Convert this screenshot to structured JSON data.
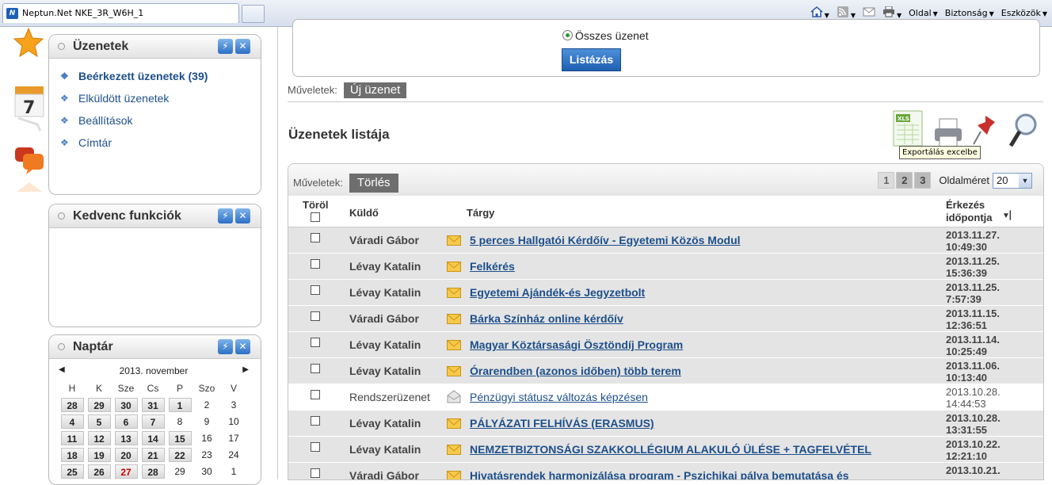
{
  "browser": {
    "tab_title": "Neptun.Net NKE_3R_W6H_1",
    "favicon_label": "N",
    "menu_page": "Oldal",
    "menu_security": "Biztonság",
    "menu_tools": "Eszközök"
  },
  "sidebar": {
    "messages_box": {
      "title": "Üzenetek",
      "items": [
        {
          "label": "Beérkezett üzenetek (39)",
          "active": true
        },
        {
          "label": "Elküldött üzenetek"
        },
        {
          "label": "Beállítások"
        },
        {
          "label": "Címtár"
        }
      ]
    },
    "favorites_box": {
      "title": "Kedvenc funkciók"
    },
    "calendar_box": {
      "title": "Naptár",
      "month": "2013. november",
      "weekdays": [
        "H",
        "K",
        "Sze",
        "Cs",
        "P",
        "Szo",
        "V"
      ],
      "weeks": [
        [
          {
            "d": "28",
            "btn": true
          },
          {
            "d": "29",
            "btn": true
          },
          {
            "d": "30",
            "btn": true
          },
          {
            "d": "31",
            "btn": true
          },
          {
            "d": "1",
            "btn": true
          },
          {
            "d": "2"
          },
          {
            "d": "3"
          }
        ],
        [
          {
            "d": "4",
            "btn": true
          },
          {
            "d": "5",
            "btn": true
          },
          {
            "d": "6",
            "btn": true
          },
          {
            "d": "7",
            "btn": true
          },
          {
            "d": "8"
          },
          {
            "d": "9"
          },
          {
            "d": "10"
          }
        ],
        [
          {
            "d": "11",
            "btn": true
          },
          {
            "d": "12",
            "btn": true
          },
          {
            "d": "13",
            "btn": true
          },
          {
            "d": "14",
            "btn": true
          },
          {
            "d": "15",
            "btn": true
          },
          {
            "d": "16"
          },
          {
            "d": "17"
          }
        ],
        [
          {
            "d": "18",
            "btn": true
          },
          {
            "d": "19",
            "btn": true
          },
          {
            "d": "20",
            "btn": true
          },
          {
            "d": "21",
            "btn": true
          },
          {
            "d": "22",
            "btn": true
          },
          {
            "d": "23"
          },
          {
            "d": "24"
          }
        ],
        [
          {
            "d": "25",
            "btn": true
          },
          {
            "d": "26",
            "btn": true
          },
          {
            "d": "27",
            "btn": true,
            "red": true
          },
          {
            "d": "28",
            "btn": true
          },
          {
            "d": "29"
          },
          {
            "d": "30"
          },
          {
            "d": "1"
          }
        ]
      ]
    }
  },
  "filter": {
    "radio_label": "Összes üzenet",
    "list_button": "Listázás"
  },
  "operations": {
    "label": "Műveletek:",
    "new_message": "Új üzenet"
  },
  "list": {
    "title": "Üzenetek listája",
    "toolbar_icons": [
      "excel-export-icon",
      "print-icon",
      "pin-icon",
      "search-icon"
    ],
    "excel_icon_text": "XLS",
    "tooltip": "Exportálás excelbe",
    "ops_label": "Műveletek:",
    "delete_button": "Törlés",
    "pages": [
      "1",
      "2",
      "3"
    ],
    "current_page": "1",
    "page_size_label": "Oldalméret",
    "page_size": "20",
    "columns": {
      "delete": "Töröl",
      "sender": "Küldő",
      "subject": "Tárgy",
      "date_line1": "Érkezés",
      "date_line2": "időpontja"
    },
    "rows": [
      {
        "sender": "Váradi Gábor",
        "subject": "5 perces Hallgatói Kérdőív - Egyetemi Közös Modul",
        "date1": "2013.11.27.",
        "date2": "10:49:30",
        "unread": true
      },
      {
        "sender": "Lévay Katalin",
        "subject": "Felkérés",
        "date1": "2013.11.25.",
        "date2": "15:36:39",
        "unread": true
      },
      {
        "sender": "Lévay Katalin",
        "subject": "Egyetemi Ajándék-és Jegyzetbolt",
        "date1": "2013.11.25.",
        "date2": "7:57:39",
        "unread": true
      },
      {
        "sender": "Váradi Gábor",
        "subject": "Bárka Színház online kérdőív",
        "date1": "2013.11.15.",
        "date2": "12:36:51",
        "unread": true
      },
      {
        "sender": "Lévay Katalin",
        "subject": "Magyar Köztársasági Ösztöndíj Program",
        "date1": "2013.11.14.",
        "date2": "10:25:49",
        "unread": true
      },
      {
        "sender": "Lévay Katalin",
        "subject": "Órarendben (azonos időben) több terem",
        "date1": "2013.11.06.",
        "date2": "10:13:40",
        "unread": true
      },
      {
        "sender": "Rendszerüzenet",
        "subject": "Pénzügyi státusz változás képzésen",
        "date1": "2013.10.28.",
        "date2": "14:44:53",
        "unread": false
      },
      {
        "sender": "Lévay Katalin",
        "subject": "PÁLYÁZATI FELHÍVÁS (ERASMUS)",
        "date1": "2013.10.28.",
        "date2": "13:31:55",
        "unread": true
      },
      {
        "sender": "Lévay Katalin",
        "subject": "NEMZETBIZTONSÁGI SZAKKOLLÉGIUM ALAKULÓ ÜLÉSE + TAGFELVÉTEL",
        "date1": "2013.10.22.",
        "date2": "12:21:10",
        "unread": true
      },
      {
        "sender": "Váradi Gábor",
        "subject": "Hivatásrendek harmonizálása program - Pszichikai pálya bemutatása és",
        "date1": "2013.10.21.",
        "date2": "",
        "unread": true
      }
    ]
  },
  "colors": {
    "accent": "#1f5fb1",
    "link": "#1d4f8b",
    "unread_row": "#e4e4e4",
    "button_gray": "#6e6e6e"
  }
}
